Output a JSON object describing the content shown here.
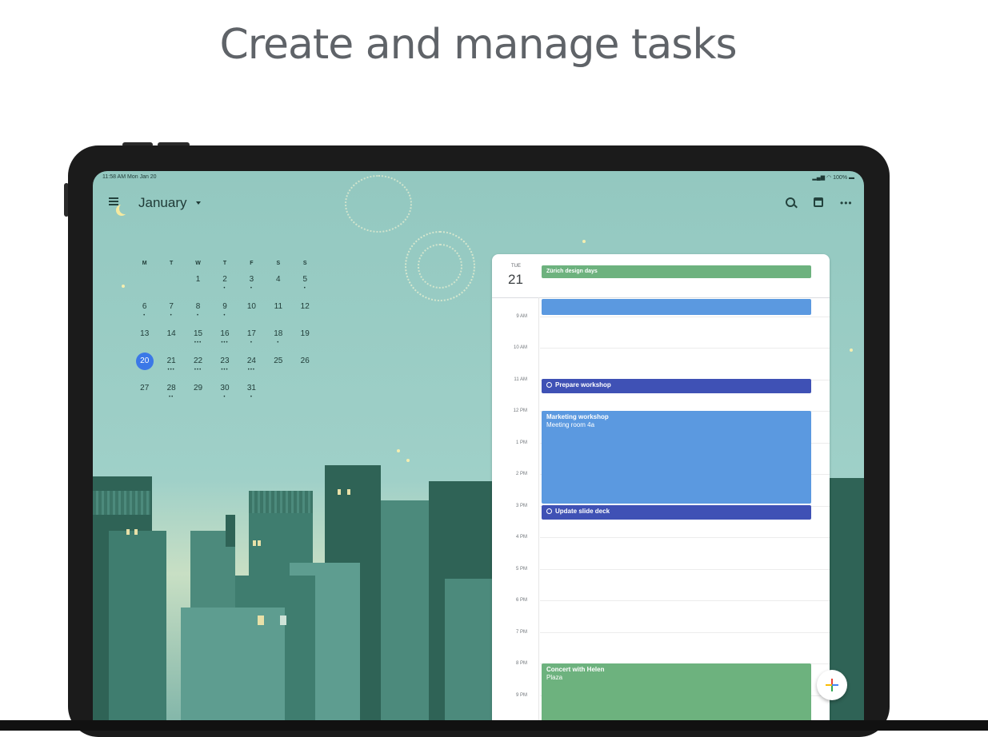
{
  "headline": "Create and manage tasks",
  "status_bar": {
    "time_date": "11:58 AM  Mon Jan 20",
    "battery": "100%"
  },
  "header": {
    "month": "January"
  },
  "mini_calendar": {
    "weekdays": [
      "M",
      "T",
      "W",
      "T",
      "F",
      "S",
      "S"
    ],
    "weeks": [
      [
        "",
        "",
        "1",
        "2",
        "3",
        "4",
        "5"
      ],
      [
        "6",
        "7",
        "8",
        "9",
        "10",
        "11",
        "12"
      ],
      [
        "13",
        "14",
        "15",
        "16",
        "17",
        "18",
        "19"
      ],
      [
        "20",
        "21",
        "22",
        "23",
        "24",
        "25",
        "26"
      ],
      [
        "27",
        "28",
        "29",
        "30",
        "31",
        "",
        ""
      ]
    ],
    "today": "20"
  },
  "day_view": {
    "day_of_week": "TUE",
    "day_number": "21",
    "all_day_event": "Zürich design days",
    "hours": [
      "9 AM",
      "10 AM",
      "11 AM",
      "12 PM",
      "1 PM",
      "2 PM",
      "3 PM",
      "4 PM",
      "5 PM",
      "6 PM",
      "7 PM",
      "8 PM",
      "9 PM"
    ],
    "events": {
      "prepare_workshop": "Prepare workshop",
      "marketing_title": "Marketing workshop",
      "marketing_location": "Meeting room 4a",
      "update_slide_deck": "Update slide deck",
      "concert_title": "Concert with Helen",
      "concert_location": "Plaza"
    }
  },
  "colors": {
    "accent_blue": "#3b78e7",
    "event_blue": "#5b99e0",
    "task_indigo": "#3f51b5",
    "event_green": "#6db27e",
    "background_teal": "#93c8c0"
  }
}
